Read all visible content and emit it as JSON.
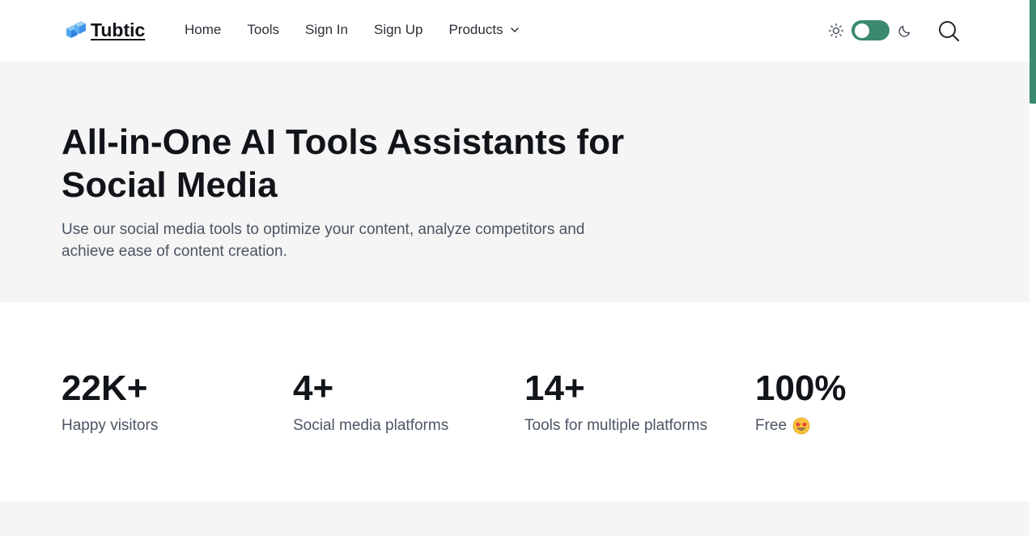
{
  "brand": {
    "name": "Tubtic"
  },
  "nav": {
    "items": [
      {
        "label": "Home"
      },
      {
        "label": "Tools"
      },
      {
        "label": "Sign In"
      },
      {
        "label": "Sign Up"
      },
      {
        "label": "Products"
      }
    ]
  },
  "theme": {
    "mode": "light",
    "accent": "#3a8a6e"
  },
  "hero": {
    "title": "All-in-One AI Tools Assistants for Social Media",
    "subtitle": "Use our social media tools to optimize your content, analyze competitors and achieve ease of content creation."
  },
  "stats": [
    {
      "value": "22K+",
      "label": "Happy visitors"
    },
    {
      "value": "4+",
      "label": "Social media platforms"
    },
    {
      "value": "14+",
      "label": "Tools for multiple platforms"
    },
    {
      "value": "100%",
      "label": "Free",
      "icon": "star-struck-emoji-icon"
    }
  ],
  "colors": {
    "hero_bg": "#f5f5f5",
    "text": "#111418",
    "muted": "#4b5563"
  }
}
